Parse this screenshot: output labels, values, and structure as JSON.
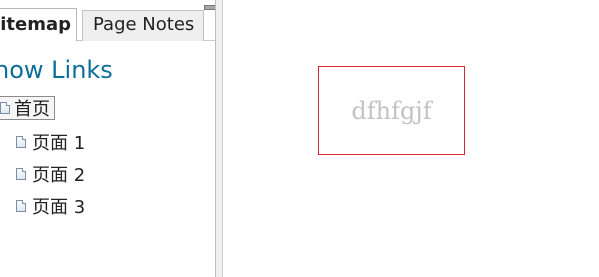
{
  "tabs": {
    "sitemap": "itemap",
    "page_notes": "Page Notes"
  },
  "sitemap": {
    "show_links": "how Links",
    "root": {
      "label": "首页",
      "icon": "page-icon"
    },
    "pages": [
      {
        "label": "页面 1",
        "icon": "page-icon"
      },
      {
        "label": "页面 2",
        "icon": "page-icon"
      },
      {
        "label": "页面 3",
        "icon": "page-icon"
      }
    ]
  },
  "canvas": {
    "widget_text": "dfhfgjf",
    "widget_border_color": "#d9262c",
    "widget_text_color": "#c3c3c3"
  },
  "colors": {
    "link": "#0e6e9a"
  }
}
